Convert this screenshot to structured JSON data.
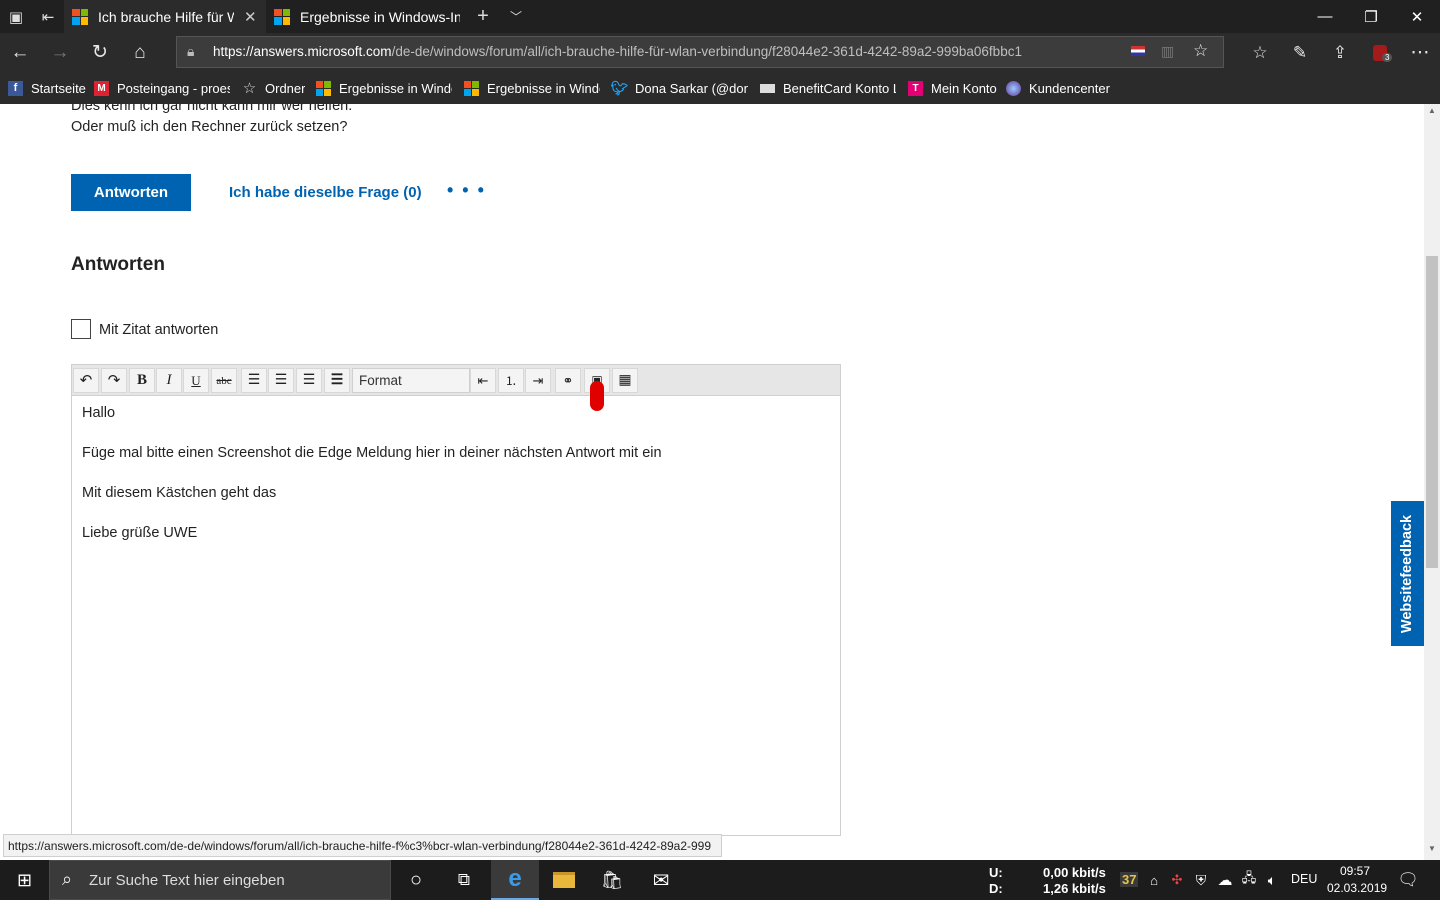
{
  "browser": {
    "tabs": [
      {
        "title": "Ich brauche Hilfe für WI",
        "active": true
      },
      {
        "title": "Ergebnisse in Windows-Insi",
        "active": false
      }
    ],
    "url_host": "https://answers.microsoft.com",
    "url_path": "/de-de/windows/forum/all/ich-brauche-hilfe-für-wlan-verbindung/f28044e2-361d-4242-89a2-999ba06fbbc1",
    "extension_badge": "3",
    "favorites": [
      {
        "label": "Startseite",
        "icon": "facebook-icon"
      },
      {
        "label": "Posteingang - proesc",
        "icon": "mail-icon"
      },
      {
        "label": "Ordner",
        "icon": "star-icon"
      },
      {
        "label": "Ergebnisse in Windov",
        "icon": "windows-icon"
      },
      {
        "label": "Ergebnisse in Windov",
        "icon": "windows-icon"
      },
      {
        "label": "Dona Sarkar (@dona:",
        "icon": "twitter-icon"
      },
      {
        "label": "BenefitCard Konto Lo",
        "icon": "card-icon"
      },
      {
        "label": "Mein Konto",
        "icon": "telekom-icon"
      },
      {
        "label": "Kundencenter",
        "icon": "globe-icon"
      }
    ]
  },
  "question": {
    "line1": "Dies kenn ich gar nicht kann mir wer helfen.",
    "line2": "Oder muß ich den Rechner zurück setzen?"
  },
  "actions": {
    "reply_label": "Antworten",
    "same_question_label": "Ich habe dieselbe Frage (0)",
    "more_label": "• • •"
  },
  "answers": {
    "heading": "Antworten",
    "quote_label": "Mit Zitat antworten"
  },
  "editor": {
    "format_label": "Format",
    "paragraphs": [
      "Hallo",
      "Füge mal bitte einen Screenshot die Edge Meldung hier in deiner nächsten Antwort mit ein",
      "Mit diesem Kästchen geht das",
      "Liebe grüße UWE"
    ]
  },
  "feedback_label": "Websitefeedback",
  "status_url": "https://answers.microsoft.com/de-de/windows/forum/all/ich-brauche-hilfe-f%c3%bcr-wlan-verbindung/f28044e2-361d-4242-89a2-999",
  "taskbar": {
    "search_placeholder": "Zur Suche Text hier eingeben",
    "net_up_label": "U:",
    "net_down_label": "D:",
    "net_up_value": "0,00 kbit/s",
    "net_down_value": "1,26 kbit/s",
    "temp": "37",
    "language": "DEU",
    "time": "09:57",
    "date": "02.03.2019"
  },
  "colors": {
    "accent": "#0063b1",
    "titlebar": "#202020",
    "toolbar": "#2b2b2b",
    "taskbar": "#1c1c1c"
  }
}
